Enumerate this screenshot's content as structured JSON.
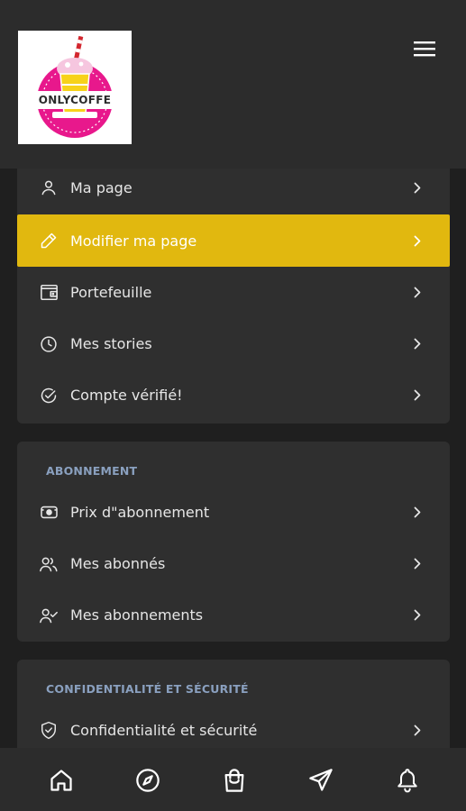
{
  "header": {
    "logo_text": "ONLYCOFFE",
    "menu_icon": "hamburger-icon"
  },
  "menu_card": {
    "items": [
      {
        "label": "Ma page",
        "icon": "user-icon"
      },
      {
        "label": "Modifier ma page",
        "icon": "pencil-icon",
        "active": true
      },
      {
        "label": "Portefeuille",
        "icon": "wallet-icon"
      },
      {
        "label": "Mes stories",
        "icon": "clock-icon"
      },
      {
        "label": "Compte vérifié!",
        "icon": "check-circle-icon"
      }
    ]
  },
  "subscription_card": {
    "title": "ABONNEMENT",
    "items": [
      {
        "label": "Prix d\"abonnement",
        "icon": "price-tag-icon"
      },
      {
        "label": "Mes abonnés",
        "icon": "users-icon"
      },
      {
        "label": "Mes abonnements",
        "icon": "user-check-icon"
      }
    ]
  },
  "privacy_card": {
    "title": "CONFIDENTIALITÉ ET SÉCURITÉ",
    "items": [
      {
        "label": "Confidentialité et sécurité",
        "icon": "shield-check-icon"
      }
    ]
  },
  "bottom_nav": {
    "items": [
      "home-icon",
      "compass-icon",
      "shopping-bag-icon",
      "send-icon",
      "bell-icon"
    ]
  },
  "colors": {
    "accent": "#e1b80f",
    "background": "#1f1f1f",
    "card": "#2f2f2f",
    "section_title": "#8aa0bf"
  }
}
